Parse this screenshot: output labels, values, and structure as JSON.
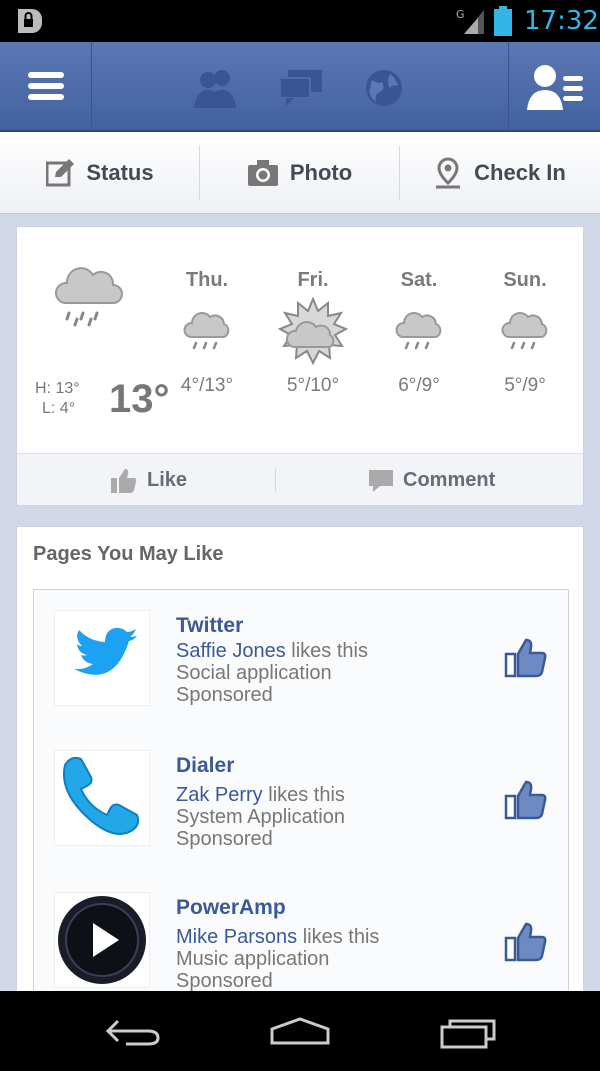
{
  "status_bar": {
    "time": "17:32",
    "network_label": "G",
    "accent_color": "#33b5e5"
  },
  "header": {
    "icons": [
      "menu-icon",
      "friend-requests-icon",
      "messages-icon",
      "notifications-globe-icon",
      "friends-list-icon"
    ]
  },
  "publisher": {
    "status_label": "Status",
    "photo_label": "Photo",
    "checkin_label": "Check In"
  },
  "weather": {
    "today": {
      "high": "H: 13°",
      "low": "L: 4°",
      "temp": "13°",
      "icon": "rain-cloud-icon"
    },
    "days": [
      {
        "name": "Thu.",
        "temps": "4°/13°",
        "icon": "rain-cloud-icon"
      },
      {
        "name": "Fri.",
        "temps": "5°/10°",
        "icon": "sun-cloud-icon"
      },
      {
        "name": "Sat.",
        "temps": "6°/9°",
        "icon": "rain-cloud-icon"
      },
      {
        "name": "Sun.",
        "temps": "5°/9°",
        "icon": "rain-cloud-icon"
      }
    ],
    "like_label": "Like",
    "comment_label": "Comment"
  },
  "pages": {
    "title": "Pages You May Like",
    "items": [
      {
        "name": "Twitter",
        "friend": "Saffie Jones",
        "likes_text": " likes this",
        "category": "Social application",
        "sponsored": "Sponsored",
        "icon": "twitter-bird-icon"
      },
      {
        "name": "Dialer",
        "friend": "Zak Perry",
        "likes_text": " likes this",
        "category": "System Application",
        "sponsored": "Sponsored",
        "icon": "phone-handset-icon"
      },
      {
        "name": "PowerAmp",
        "friend": "Mike Parsons",
        "likes_text": " likes this",
        "category": "Music application",
        "sponsored": "Sponsored",
        "icon": "play-button-icon"
      }
    ]
  },
  "colors": {
    "fb_blue": "#3b5998",
    "header_blue": "#4f6aa8",
    "twitter_blue": "#1da1f2"
  }
}
